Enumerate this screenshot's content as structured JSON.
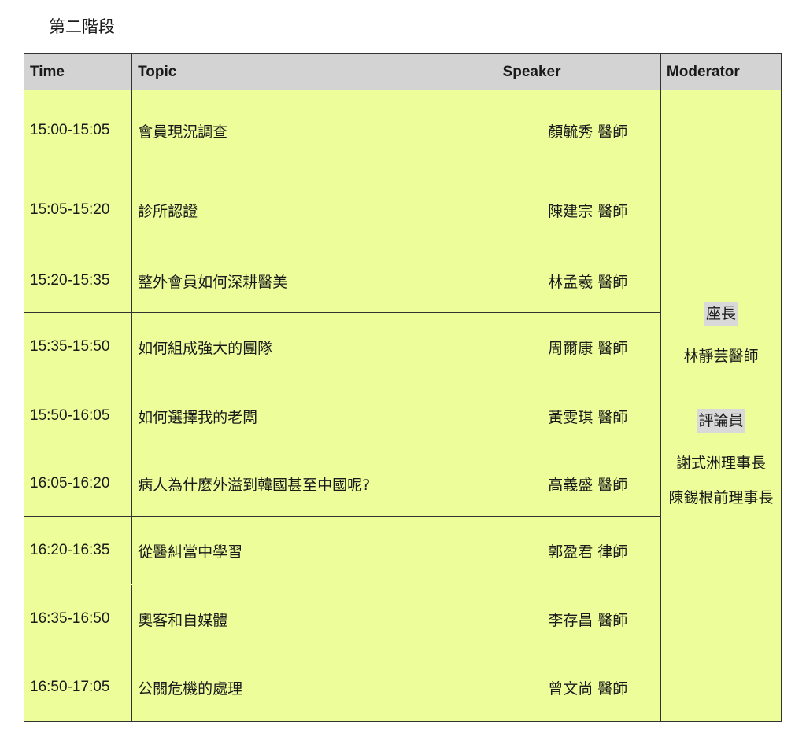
{
  "section_title": "第二階段",
  "table": {
    "headers": {
      "time": "Time",
      "topic": "Topic",
      "speaker": "Speaker",
      "moderator": "Moderator"
    },
    "rows": [
      {
        "time": "15:00-15:05",
        "topic": "會員現況調查",
        "speaker": "顏毓秀 醫師"
      },
      {
        "time": "15:05-15:20",
        "topic": "診所認證",
        "speaker": "陳建宗 醫師"
      },
      {
        "time": "15:20-15:35",
        "topic": "整外會員如何深耕醫美",
        "speaker": "林孟羲 醫師"
      },
      {
        "time": "15:35-15:50",
        "topic": "如何組成強大的團隊",
        "speaker": "周爾康 醫師"
      },
      {
        "time": "15:50-16:05",
        "topic": "如何選擇我的老闆",
        "speaker": "黃雯琪 醫師"
      },
      {
        "time": "16:05-16:20",
        "topic": "病人為什麼外溢到韓國甚至中國呢?",
        "speaker": "高義盛 醫師"
      },
      {
        "time": "16:20-16:35",
        "topic": "從醫糾當中學習",
        "speaker": "郭盈君 律師"
      },
      {
        "time": "16:35-16:50",
        "topic": "奧客和自媒體",
        "speaker": "李存昌 醫師"
      },
      {
        "time": "16:50-17:05",
        "topic": "公關危機的處理",
        "speaker": "曾文尚 醫師"
      }
    ],
    "moderator": {
      "chair_label": "座長",
      "chair_name": "林靜芸醫師",
      "reviewer_label": "評論員",
      "reviewer_1": "謝式洲理事長",
      "reviewer_2": "陳錫根前理事長"
    }
  },
  "colors": {
    "header_bg": "#d3d3d3",
    "body_bg": "#edfd9a",
    "label_highlight": "#d9d9d9"
  }
}
